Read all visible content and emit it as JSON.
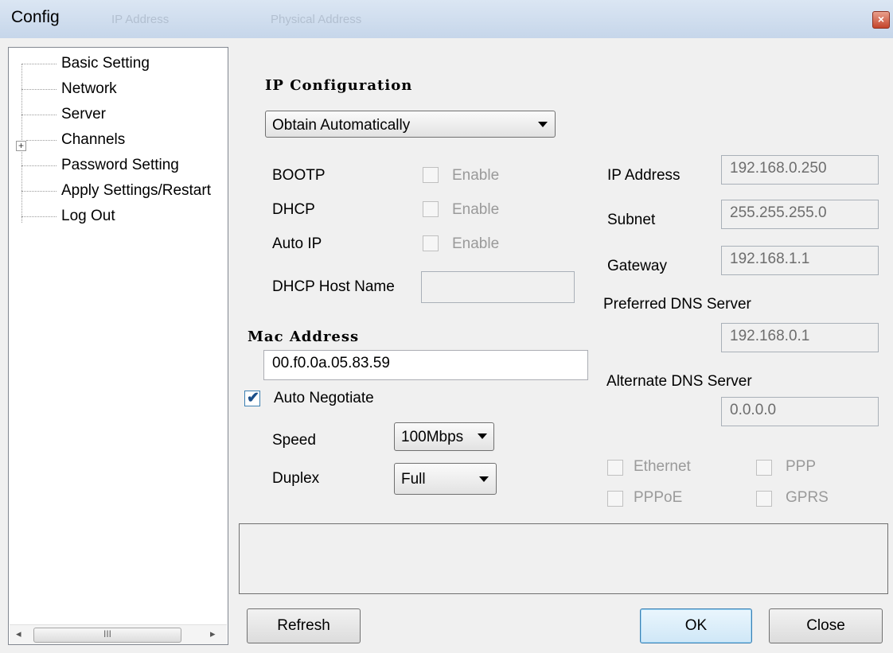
{
  "window": {
    "title": "Config",
    "close_glyph": "×",
    "ghost_columns": [
      "IP Address",
      "Physical Address"
    ]
  },
  "tree": {
    "items": [
      {
        "label": "Basic Setting"
      },
      {
        "label": "Network"
      },
      {
        "label": "Server"
      },
      {
        "label": "Channels",
        "expander": "+"
      },
      {
        "label": "Password Setting"
      },
      {
        "label": "Apply Settings/Restart"
      },
      {
        "label": "Log Out"
      }
    ],
    "scroll": {
      "left": "◂",
      "right": "▸",
      "grip": "III"
    }
  },
  "ip_config": {
    "heading": "IP Configuration",
    "mode": "Obtain Automatically",
    "options": [
      {
        "label": "BOOTP",
        "checkbox_label": "Enable",
        "checked": false
      },
      {
        "label": "DHCP",
        "checkbox_label": "Enable",
        "checked": false
      },
      {
        "label": "Auto IP",
        "checkbox_label": "Enable",
        "checked": false
      }
    ],
    "dhcp_host_name_label": "DHCP Host Name",
    "dhcp_host_name": ""
  },
  "addresses": {
    "ip_label": "IP Address",
    "ip": "192.168.0.250",
    "subnet_label": "Subnet",
    "subnet": "255.255.255.0",
    "gateway_label": "Gateway",
    "gateway": "192.168.1.1",
    "pref_dns_label": "Preferred DNS Server",
    "pref_dns": "192.168.0.1",
    "alt_dns_label": "Alternate DNS Server",
    "alt_dns": "0.0.0.0"
  },
  "mac": {
    "heading": "Mac Address",
    "value": "00.f0.0a.05.83.59"
  },
  "link": {
    "auto_negotiate_label": "Auto Negotiate",
    "auto_negotiate": true,
    "check_glyph": "✔",
    "speed_label": "Speed",
    "speed": "100Mbps",
    "duplex_label": "Duplex",
    "duplex": "Full"
  },
  "interfaces": [
    {
      "label": "Ethernet",
      "checked": false
    },
    {
      "label": "PPP",
      "checked": false
    },
    {
      "label": "PPPoE",
      "checked": false
    },
    {
      "label": "GPRS",
      "checked": false
    }
  ],
  "buttons": {
    "refresh": "Refresh",
    "ok": "OK",
    "close": "Close"
  },
  "colors": {
    "titlebar": "#c6d6ea",
    "close": "#c4452c",
    "default_button": "#3c7fb1"
  }
}
